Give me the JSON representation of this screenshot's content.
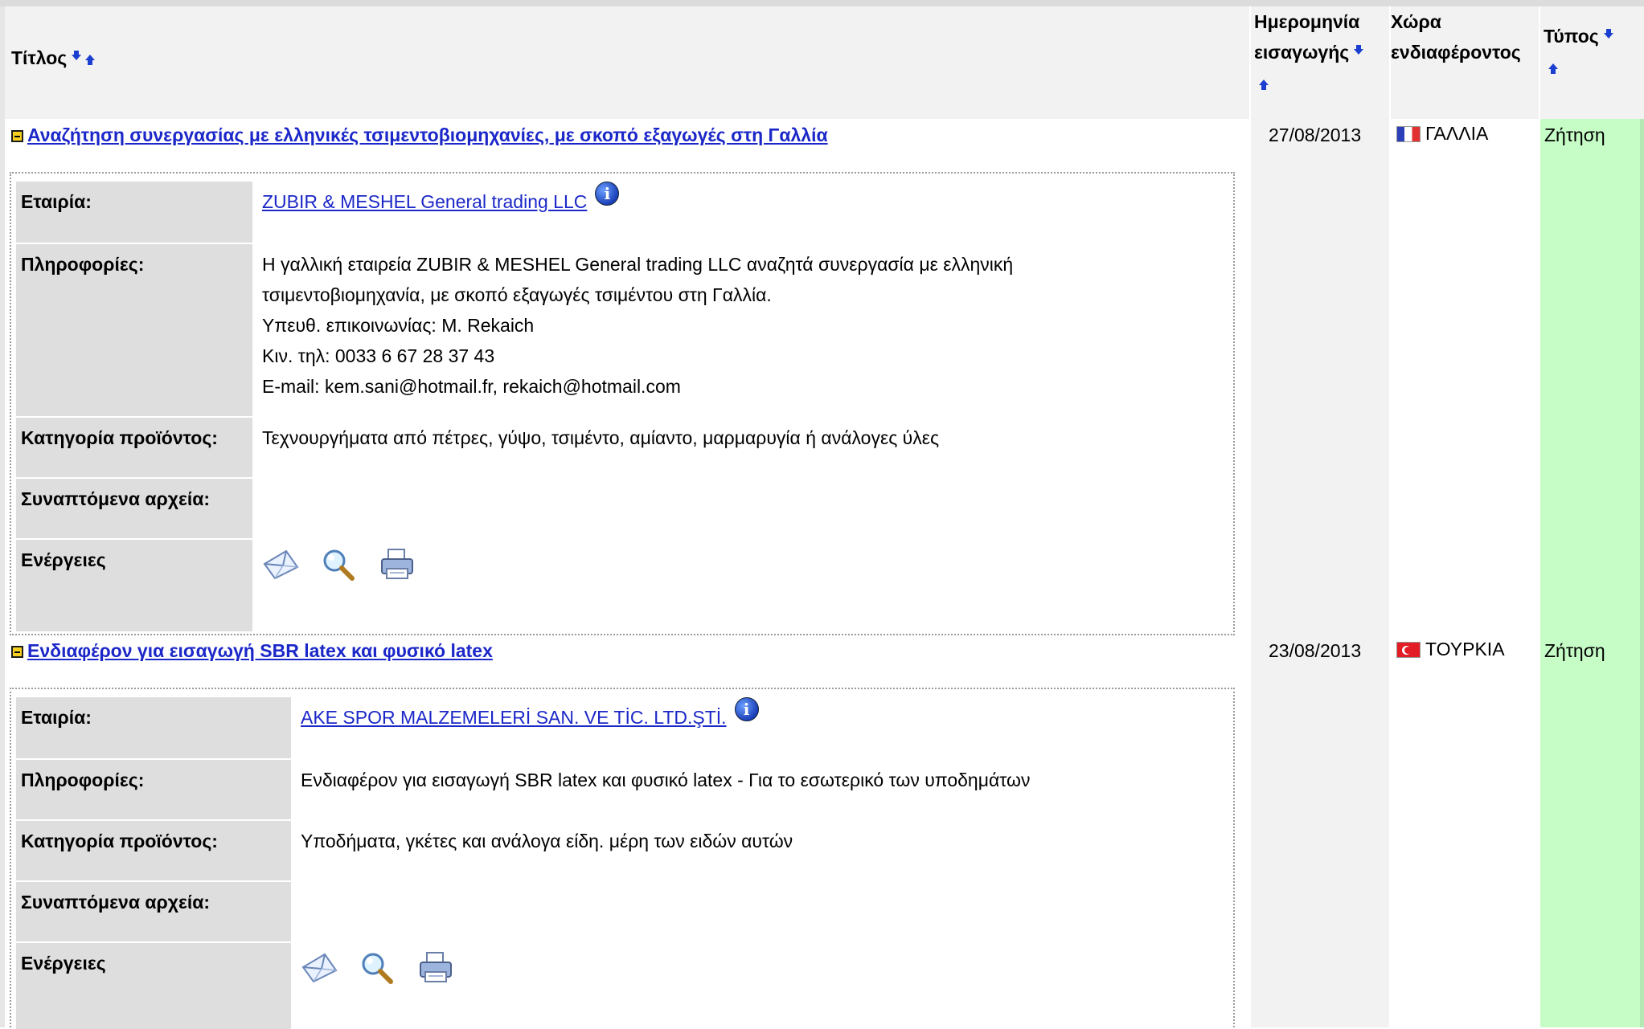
{
  "header": {
    "title_col": "Τίτλος",
    "date_col_line1": "Ημερομηνία",
    "date_col_line2": "εισαγωγής",
    "country_col_line1": "Χώρα",
    "country_col_line2": "ενδιαφέροντος",
    "type_col": "Τύπος"
  },
  "labels": {
    "company": "Εταιρία:",
    "info": "Πληροφορίες:",
    "category": "Κατηγορία προϊόντος:",
    "attachments": "Συναπτόμενα αρχεία:",
    "actions": "Ενέργειες"
  },
  "records": [
    {
      "title": "Αναζήτηση συνεργασίας με ελληνικές τσιμεντοβιομηχανίες, με σκοπό εξαγωγές στη Γαλλία",
      "date": "27/08/2013",
      "country": "ΓΑΛΛΙΑ",
      "type": "Ζήτηση",
      "company": "ZUBIR & MESHEL General trading LLC",
      "info_lines": [
        "Η γαλλική εταιρεία ZUBIR & MESHEL General trading LLC αναζητά συνεργασία με ελληνική",
        "τσιμεντοβιομηχανία, με σκοπό εξαγωγές τσιμέντου στη Γαλλία.",
        "Υπευθ. επικοινωνίας: M. Rekaich",
        "Κιν. τηλ: 0033 6 67 28 37 43",
        "E-mail: kem.sani@hotmail.fr, rekaich@hotmail.com"
      ],
      "category": "Τεχνουργήματα από πέτρες, γύψο, τσιμέντο, αμίαντο, μαρμαρυγία ή ανάλογες ύλες",
      "attachments": ""
    },
    {
      "title": "Ενδιαφέρον για εισαγωγή SBR latex και φυσικό latex",
      "date": "23/08/2013",
      "country": "ΤΟΥΡΚΙΑ",
      "type": "Ζήτηση",
      "company": "AKE SPOR MALZEMELERİ SAN. VE TİC. LTD.ŞTİ.",
      "info_lines": [
        "Ενδιαφέρον για εισαγωγή SBR latex και φυσικό latex - Για το εσωτερικό των υποδημάτων"
      ],
      "category": "Υποδήματα, γκέτες και ανάλογα είδη. μέρη των ειδών αυτών",
      "attachments": ""
    }
  ],
  "icons": {
    "sort_down": "sort-desc-icon",
    "sort_up": "sort-asc-icon",
    "collapse": "collapse-icon",
    "info": "info-icon",
    "email": "envelope-icon",
    "view": "magnifier-icon",
    "print": "printer-icon"
  },
  "colors": {
    "link": "#1b27c8",
    "type_bg": "#c6fcc6",
    "label_bg": "#dedede",
    "header_bg": "#f2f2f2"
  }
}
